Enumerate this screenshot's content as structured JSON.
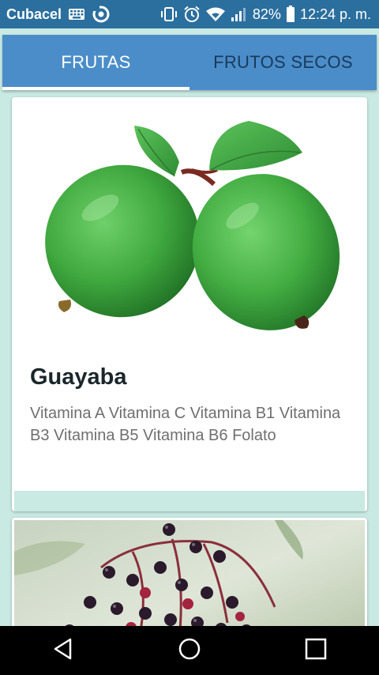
{
  "status_bar": {
    "carrier": "Cubacel",
    "battery_percent": "82%",
    "time": "12:24 p. m.",
    "icons": [
      "keyboard-icon",
      "sync-icon",
      "vibrate-icon",
      "alarm-icon",
      "wifi-icon",
      "signal-icon",
      "battery-icon"
    ]
  },
  "tabs": [
    {
      "label": "FRUTAS",
      "active": true
    },
    {
      "label": "FRUTOS SECOS",
      "active": false
    }
  ],
  "cards": [
    {
      "title": "Guayaba",
      "description": "Vitamina A Vitamina C Vitamina B1 Vitamina B3 Vitamina B5 Vitamina B6 Folato"
    }
  ],
  "nav_bar": {
    "icons": [
      "back-icon",
      "home-icon",
      "recents-icon"
    ]
  },
  "colors": {
    "status_bar": "#2b6f9e",
    "tab_bar": "#4b8dc9",
    "background": "#c9e9e3",
    "title_text": "#1b262b",
    "desc_text": "#6f6f6f"
  }
}
